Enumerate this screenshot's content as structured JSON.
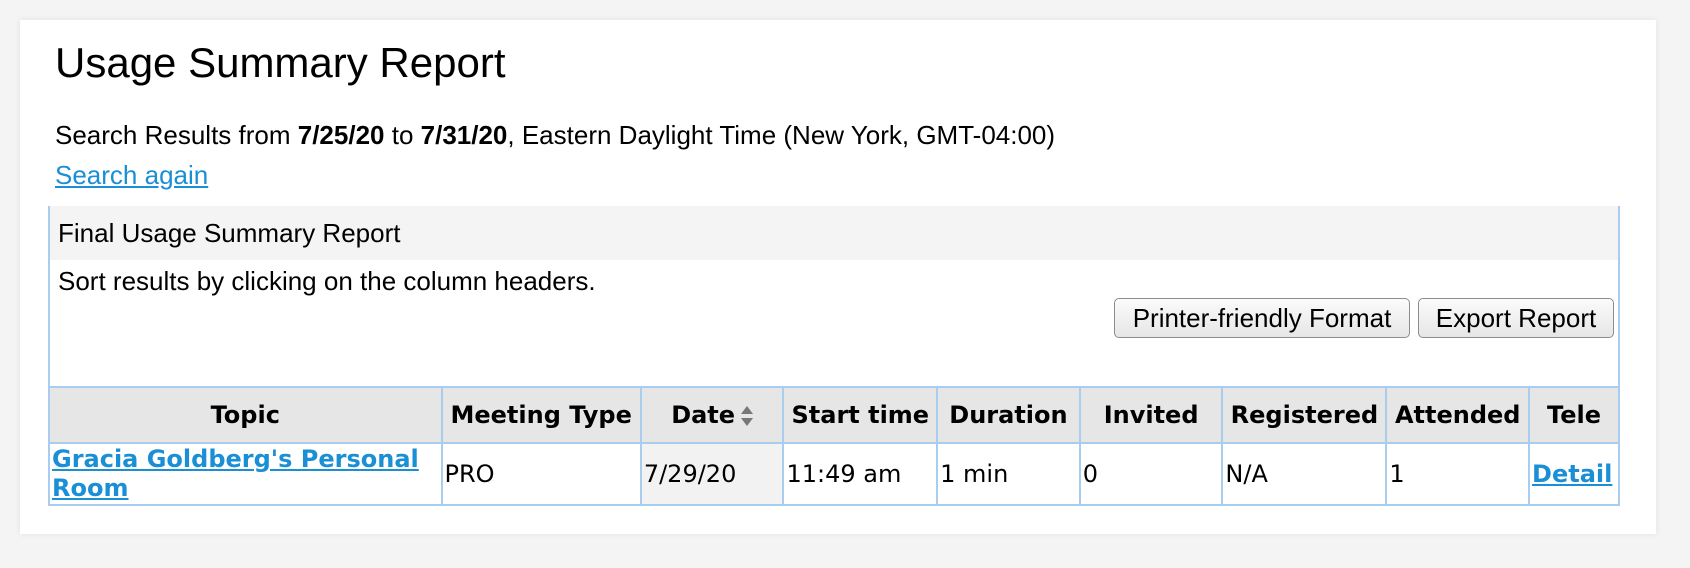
{
  "page": {
    "title": "Usage Summary Report",
    "search_prefix": "Search Results from ",
    "from_date": "7/25/20",
    "to_word": " to ",
    "to_date": "7/31/20",
    "timezone_suffix": ", Eastern Daylight Time (New York, GMT-04:00)",
    "search_again": "Search again"
  },
  "report": {
    "header": "Final Usage Summary Report",
    "sort_hint": "Sort results by clicking on the column headers.",
    "printer_button": "Printer-friendly Format",
    "export_button": "Export Report"
  },
  "table": {
    "columns": [
      "Topic",
      "Meeting Type",
      "Date",
      "Start time",
      "Duration",
      "Invited",
      "Registered",
      "Attended",
      "Tele"
    ],
    "sorted_column_icon": "sort-updown-icon",
    "rows": [
      {
        "topic": "Gracia Goldberg's Personal Room",
        "meeting_type": "PRO",
        "date": "7/29/20",
        "start_time": "11:49 am",
        "duration": "1 min",
        "invited": "0",
        "registered": "N/A",
        "attended": "1",
        "tele": "Detail"
      }
    ]
  },
  "colors": {
    "link": "#1a8fd6",
    "border": "#a8cdf0",
    "header_bg": "#e6e6e6"
  }
}
